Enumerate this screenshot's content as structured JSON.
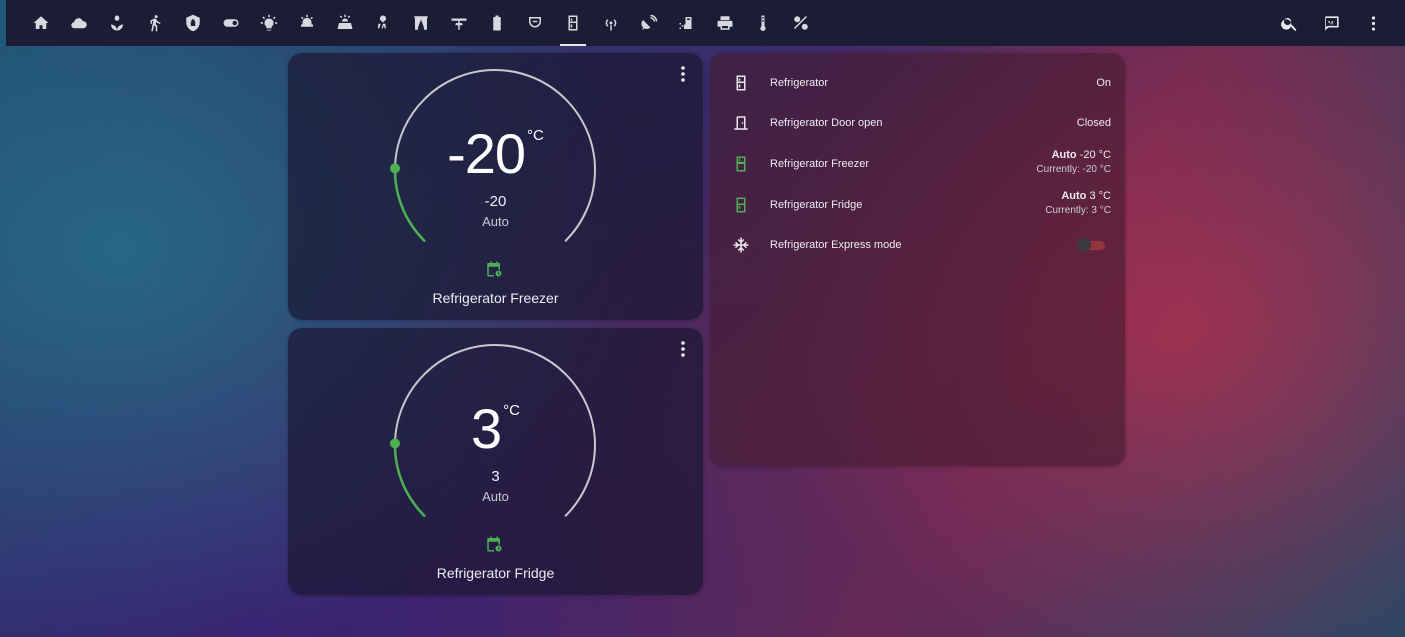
{
  "toolbar": {
    "views": [
      {
        "icon": "home-icon"
      },
      {
        "icon": "weather-cloud-icon"
      },
      {
        "icon": "flower-icon"
      },
      {
        "icon": "motion-icon"
      },
      {
        "icon": "security-icon"
      },
      {
        "icon": "toggle-icon"
      },
      {
        "icon": "light-bulb-icon"
      },
      {
        "icon": "alarm-light-icon"
      },
      {
        "icon": "solar-panel-icon"
      },
      {
        "icon": "air-conditioner-icon"
      },
      {
        "icon": "curtains-icon"
      },
      {
        "icon": "ceiling-fan-icon"
      },
      {
        "icon": "battery-icon"
      },
      {
        "icon": "robot-vacuum-icon"
      },
      {
        "icon": "fridge-icon",
        "active": true
      },
      {
        "icon": "wireless-icon"
      },
      {
        "icon": "satellite-dish-icon"
      },
      {
        "icon": "washing-icon"
      },
      {
        "icon": "printer-icon"
      },
      {
        "icon": "thermometer-icon"
      },
      {
        "icon": "tools-icon"
      }
    ],
    "actions": [
      {
        "icon": "search-icon"
      },
      {
        "icon": "assist-icon"
      },
      {
        "icon": "more-vertical-icon"
      }
    ]
  },
  "thermostats": {
    "freezer": {
      "current": "-20",
      "unit": "°C",
      "target": "-20",
      "mode": "Auto",
      "name": "Refrigerator Freezer",
      "level": 0.17
    },
    "fridge": {
      "current": "3",
      "unit": "°C",
      "target": "3",
      "mode": "Auto",
      "name": "Refrigerator Fridge",
      "level": 0.17
    }
  },
  "entities": [
    {
      "name": "Refrigerator",
      "state": "On",
      "icon": "fridge-icon"
    },
    {
      "name": "Refrigerator Door open",
      "state": "Closed",
      "icon": "door-icon"
    },
    {
      "name": "Refrigerator Freezer",
      "state_bold": "Auto",
      "state": "-20 °C",
      "sub": "Currently: -20 °C",
      "icon": "fridge-bottom-icon"
    },
    {
      "name": "Refrigerator Fridge",
      "state_bold": "Auto",
      "state": "3 °C",
      "sub": "Currently: 3 °C",
      "icon": "fridge-top-icon"
    },
    {
      "name": "Refrigerator Express mode",
      "toggle": false,
      "icon": "snowflake-icon"
    }
  ],
  "colors": {
    "accent_green": "#4caf50",
    "arc_gray": "#c8c8cc",
    "toolbar_bg": "#1a1d33"
  }
}
